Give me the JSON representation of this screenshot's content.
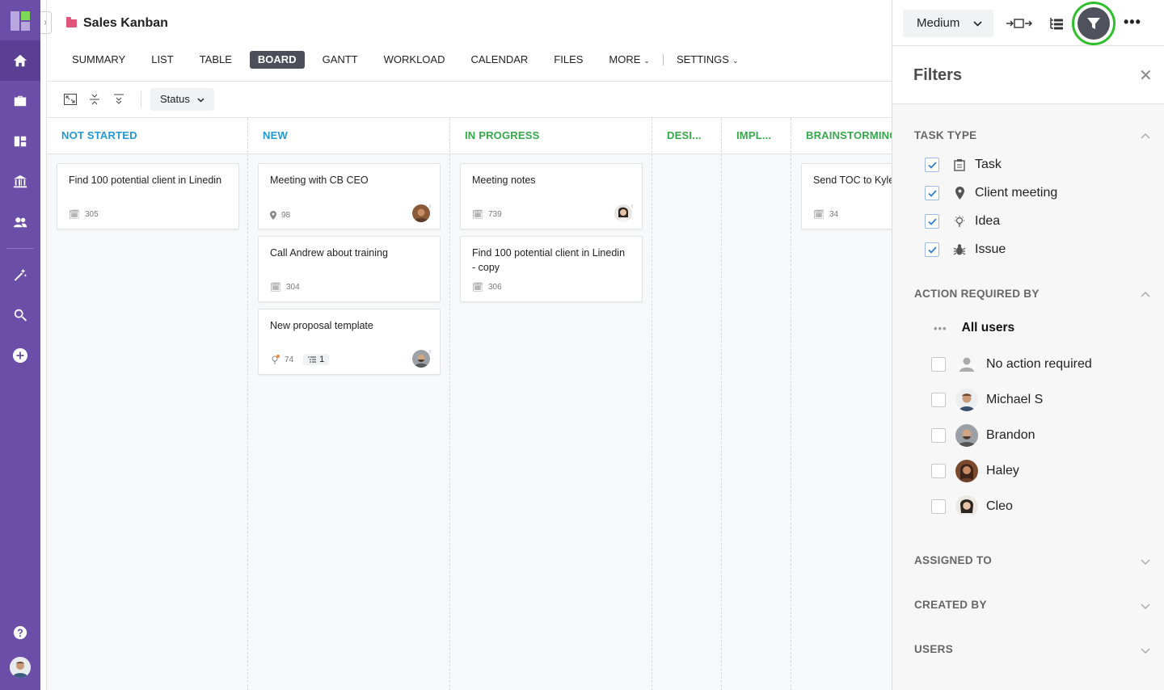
{
  "project": {
    "title": "Sales Kanban"
  },
  "tabs": [
    {
      "label": "SUMMARY"
    },
    {
      "label": "LIST"
    },
    {
      "label": "TABLE"
    },
    {
      "label": "BOARD",
      "active": true
    },
    {
      "label": "GANTT"
    },
    {
      "label": "WORKLOAD"
    },
    {
      "label": "CALENDAR"
    },
    {
      "label": "FILES"
    },
    {
      "label": "MORE"
    },
    {
      "label": "SETTINGS"
    }
  ],
  "toolbar": {
    "group_by": "Status"
  },
  "columns": [
    {
      "title": "NOT STARTED",
      "color": "#1f9ad6"
    },
    {
      "title": "NEW",
      "color": "#1f9ad6"
    },
    {
      "title": "IN PROGRESS",
      "color": "#35a94a"
    },
    {
      "title": "DESI...",
      "color": "#35a94a"
    },
    {
      "title": "IMPL...",
      "color": "#35a94a"
    },
    {
      "title": "BRAINSTORMING",
      "color": "#35a94a"
    }
  ],
  "cards": {
    "c1": {
      "title": "Find 100 potential client in Linedin",
      "id": "305",
      "type_icon": "task-icon"
    },
    "c2": {
      "title": "Meeting with CB CEO",
      "id": "98",
      "type_icon": "location-pin-icon"
    },
    "c3": {
      "title": "Call Andrew about training",
      "id": "304",
      "type_icon": "task-icon"
    },
    "c4": {
      "title": "New proposal template",
      "id": "74",
      "type_icon": "idea-icon",
      "subtasks": "1"
    },
    "c5": {
      "title": "Meeting notes",
      "id": "739",
      "type_icon": "task-icon"
    },
    "c6": {
      "title": "Find 100 potential client in Linedin - copy",
      "id": "306",
      "type_icon": "task-icon"
    },
    "c7": {
      "title": "Send TOC to Kyle",
      "id": "34",
      "type_icon": "task-icon"
    }
  },
  "panel": {
    "density": "Medium",
    "title": "Filters",
    "sections": {
      "task_type": "TASK TYPE",
      "action_required_by": "ACTION REQUIRED BY",
      "assigned_to": "ASSIGNED TO",
      "created_by": "CREATED BY",
      "users": "USERS"
    },
    "task_types": [
      {
        "label": "Task",
        "checked": true
      },
      {
        "label": "Client meeting",
        "checked": true
      },
      {
        "label": "Idea",
        "checked": true
      },
      {
        "label": "Issue",
        "checked": true
      }
    ],
    "all_users": "All users",
    "users": [
      {
        "label": "No action required"
      },
      {
        "label": "Michael S"
      },
      {
        "label": "Brandon"
      },
      {
        "label": "Haley"
      },
      {
        "label": "Cleo"
      }
    ]
  },
  "colors": {
    "rail": "#6b4ea8",
    "accent_green": "#2fbf2a",
    "checkbox_blue": "#2f7fd6"
  }
}
